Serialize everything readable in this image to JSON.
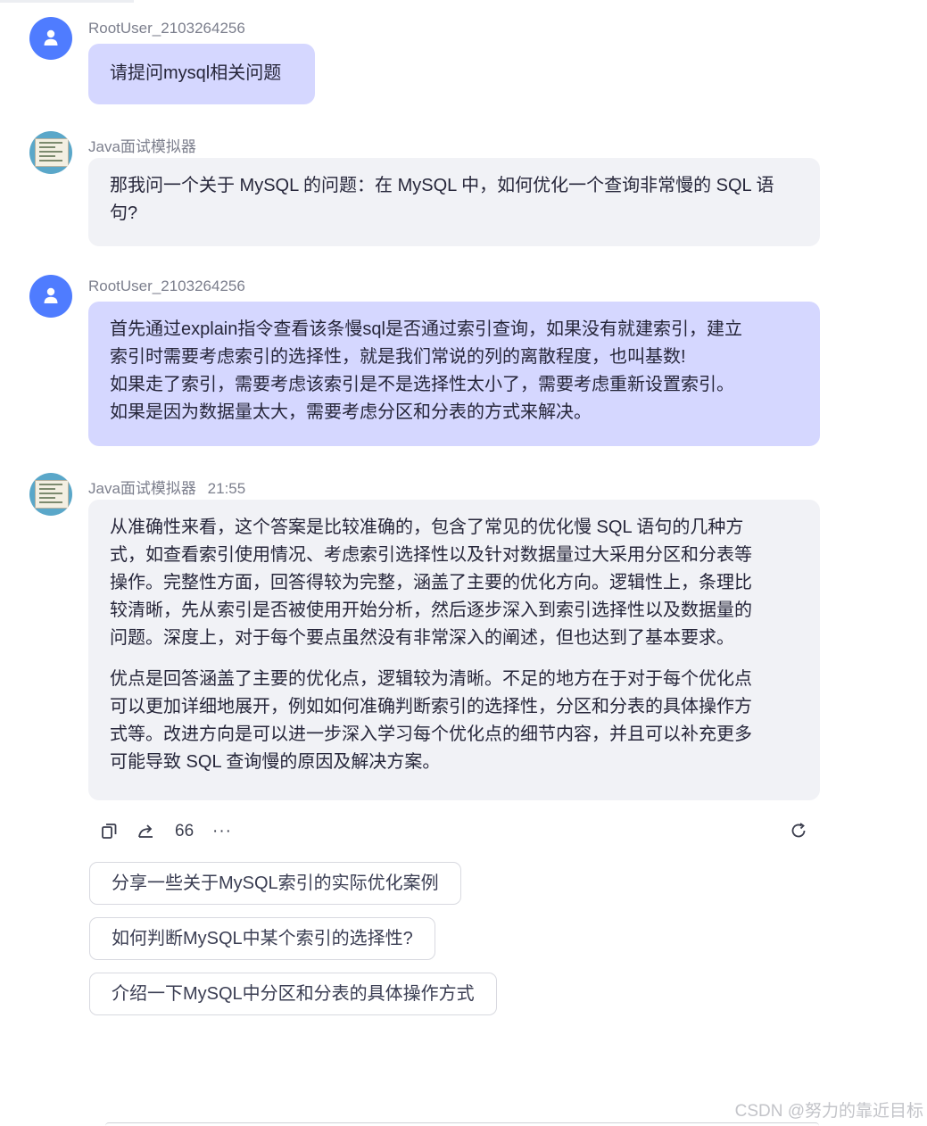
{
  "messages": [
    {
      "sender": "RootUser_2103264256",
      "role": "user",
      "lines": [
        "请提问mysql相关问题"
      ]
    },
    {
      "sender": "Java面试模拟器",
      "role": "bot",
      "lines": [
        "那我问一个关于 MySQL 的问题：在 MySQL 中，如何优化一个查询非常慢的 SQL 语",
        "句?"
      ]
    },
    {
      "sender": "RootUser_2103264256",
      "role": "user",
      "lines": [
        "首先通过explain指令查看该条慢sql是否通过索引查询，如果没有就建索引，建立",
        "索引时需要考虑索引的选择性，就是我们常说的列的离散程度，也叫基数!",
        "如果走了索引，需要考虑该索引是不是选择性太小了，需要考虑重新设置索引。",
        "如果是因为数据量太大，需要考虑分区和分表的方式来解决。"
      ]
    },
    {
      "sender": "Java面试模拟器",
      "time": "21:55",
      "role": "bot",
      "paragraph1": [
        "从准确性来看，这个答案是比较准确的，包含了常见的优化慢 SQL 语句的几种方",
        "式，如查看索引使用情况、考虑索引选择性以及针对数据量过大采用分区和分表等",
        "操作。完整性方面，回答得较为完整，涵盖了主要的优化方向。逻辑性上，条理比",
        "较清晰，先从索引是否被使用开始分析，然后逐步深入到索引选择性以及数据量的",
        "问题。深度上，对于每个要点虽然没有非常深入的阐述，但也达到了基本要求。"
      ],
      "paragraph2": [
        "优点是回答涵盖了主要的优化点，逻辑较为清晰。不足的地方在于对于每个优化点",
        "可以更加详细地展开，例如如何准确判断索引的选择性，分区和分表的具体操作方",
        "式等。改进方向是可以进一步深入学习每个优化点的细节内容，并且可以补充更多",
        "可能导致 SQL 查询慢的原因及解决方案。"
      ]
    }
  ],
  "actions": {
    "copy_icon": "copy-icon",
    "share_icon": "share-icon",
    "quote_label": "66",
    "more_label": "···",
    "regenerate_icon": "refresh-icon"
  },
  "suggestions": [
    "分享一些关于MySQL索引的实际优化案例",
    "如何判断MySQL中某个索引的选择性?",
    "介绍一下MySQL中分区和分表的具体操作方式"
  ],
  "watermark": "CSDN @努力的靠近目标",
  "colors": {
    "user_bubble": "#d5d7ff",
    "bot_bubble": "#f1f2f6",
    "user_avatar": "#4f7cff"
  }
}
